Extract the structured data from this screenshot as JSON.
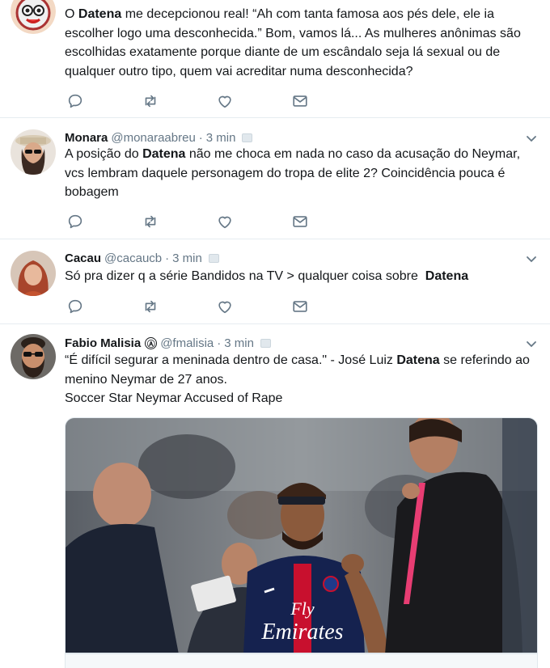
{
  "tweets": [
    {
      "avatar": "cartoon-face-avatar",
      "text_parts": [
        "O ",
        "Datena",
        " me decepcionou real! “Ah com tanta famosa aos pés dele, ele ia escolher logo uma desconhecida.” Bom, vamos lá... As mulheres anônimas são escolhidas exatamente porque diante de um escândalo seja lá sexual ou de qualquer outro tipo, quem vai acreditar numa desconhecida?"
      ]
    },
    {
      "name": "Monara",
      "handle": "@monaraabreu",
      "dot": "·",
      "time": "3 min",
      "avatar": "woman-sunglasses-avatar",
      "text_parts": [
        "A posição do ",
        "Datena",
        " não me choca em nada no caso da acusação do Neymar, vcs lembram daquele personagem do tropa de elite 2? Coincidência pouca é bobagem"
      ]
    },
    {
      "name": "Cacau",
      "handle": "@cacaucb",
      "dot": "·",
      "time": "3 min",
      "avatar": "red-hair-woman-avatar",
      "text_parts": [
        "Só pra dizer q a série Bandidos na TV > qualquer coisa sobre ",
        " Datena",
        ""
      ]
    },
    {
      "name": "Fabio Malisia",
      "verified_glyph": "Ⓐ",
      "handle": "@fmalisia",
      "dot": "·",
      "time": "3 min",
      "avatar": "bearded-man-sunglasses-avatar",
      "text_parts": [
        "“É difícil segurar a meninada dentro de casa.\" - José Luiz ",
        "Datena",
        " se referindo ao menino Neymar de 27 anos."
      ],
      "link_title": "Soccer Star Neymar Accused of Rape",
      "media_text": {
        "jersey_line1": "Fly",
        "jersey_line2": "Emirates"
      }
    }
  ],
  "icons": {
    "reply": "reply-icon",
    "retweet": "retweet-icon",
    "like": "heart-icon",
    "dm": "envelope-icon",
    "caret": "chevron-down-icon"
  },
  "colors": {
    "text": "#14171a",
    "secondary": "#657786",
    "border": "#e6ecf0"
  }
}
